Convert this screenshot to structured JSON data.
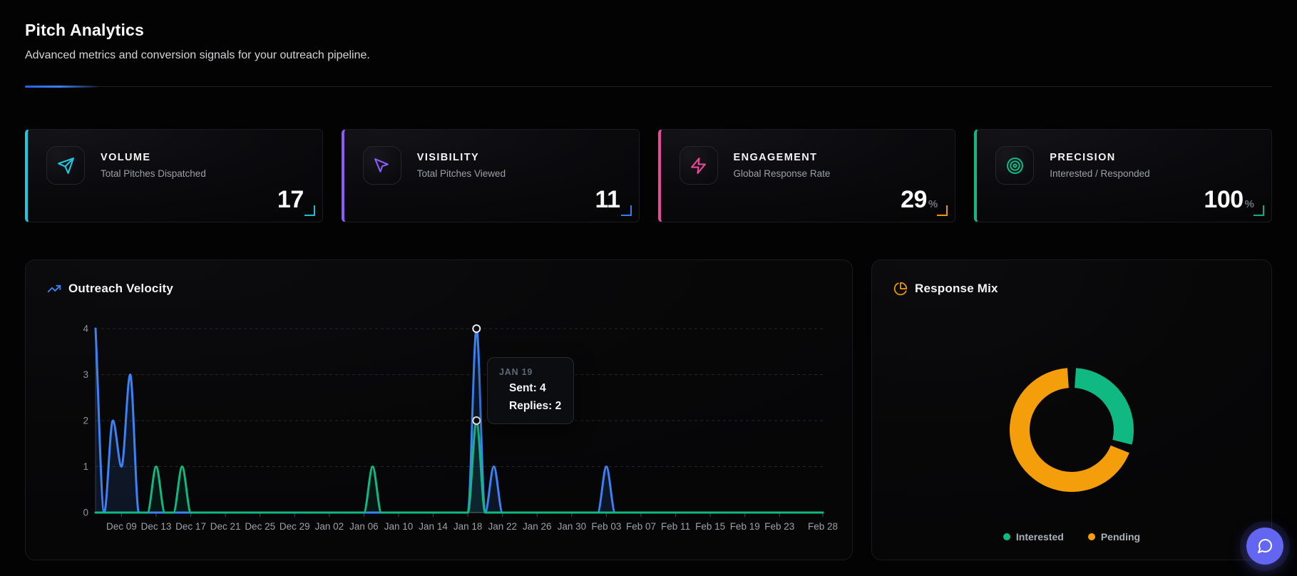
{
  "header": {
    "title": "Pitch Analytics",
    "subtitle": "Advanced metrics and conversion signals for your outreach pipeline."
  },
  "stats": [
    {
      "label": "VOLUME",
      "description": "Total Pitches Dispatched",
      "value": "17",
      "suffix": "",
      "accent": "#1fc8e0",
      "corner": "#1fc8e0",
      "icon": "send-icon"
    },
    {
      "label": "VISIBILITY",
      "description": "Total Pitches Viewed",
      "value": "11",
      "suffix": "",
      "accent": "#8b5cf6",
      "corner": "#3b82f6",
      "icon": "cursor-icon"
    },
    {
      "label": "ENGAGEMENT",
      "description": "Global Response Rate",
      "value": "29",
      "suffix": "%",
      "accent": "#ec4899",
      "corner": "#f59e0b",
      "icon": "bolt-icon"
    },
    {
      "label": "PRECISION",
      "description": "Interested / Responded",
      "value": "100",
      "suffix": "%",
      "accent": "#10b981",
      "corner": "#10b981",
      "icon": "target-icon"
    }
  ],
  "velocity": {
    "title": "Outreach Velocity",
    "title_icon": "trending-up-icon",
    "tooltip": {
      "date": "JAN 19",
      "sent": "Sent: 4",
      "replies": "Replies: 2"
    }
  },
  "mix": {
    "title": "Response Mix",
    "title_icon": "pie-chart-icon"
  },
  "chat": {
    "icon": "chat-icon",
    "color": "#6366f1"
  },
  "chart_data": [
    {
      "type": "line",
      "title": "Outreach Velocity",
      "xlabel": "",
      "ylabel": "",
      "ylim": [
        0,
        4
      ],
      "y_ticks": [
        0,
        1,
        2,
        3,
        4
      ],
      "grid": "dashed-horizontal",
      "legend_position": "none",
      "x_start_date": "Dec 06",
      "x_days_total": 84,
      "x_tick_labels": [
        "Dec 09",
        "Dec 13",
        "Dec 17",
        "Dec 21",
        "Dec 25",
        "Dec 29",
        "Jan 02",
        "Jan 06",
        "Jan 10",
        "Jan 14",
        "Jan 18",
        "Jan 22",
        "Jan 26",
        "Jan 30",
        "Feb 03",
        "Feb 07",
        "Feb 11",
        "Feb 15",
        "Feb 19",
        "Feb 23",
        "Feb 28"
      ],
      "x_tick_offsets": [
        3,
        7,
        11,
        15,
        19,
        23,
        27,
        31,
        35,
        39,
        43,
        47,
        51,
        55,
        59,
        63,
        67,
        71,
        75,
        79,
        84
      ],
      "series": [
        {
          "name": "Sent",
          "color": "#3b82f6",
          "fill": "rgba(59,130,246,0.13)",
          "baseline": 0,
          "points": [
            [
              0,
              4
            ],
            [
              2,
              2
            ],
            [
              3,
              1
            ],
            [
              4,
              3
            ],
            [
              44,
              4
            ],
            [
              46,
              1
            ],
            [
              59,
              1
            ]
          ]
        },
        {
          "name": "Replies",
          "color": "#10b981",
          "fill": "rgba(16,185,129,0.09)",
          "baseline": 0,
          "points": [
            [
              7,
              1
            ],
            [
              10,
              1
            ],
            [
              32,
              1
            ],
            [
              44,
              2
            ]
          ]
        }
      ],
      "highlight": {
        "date": "Jan 19",
        "offset": 44,
        "points": [
          [
            44,
            4
          ],
          [
            44,
            2
          ]
        ]
      }
    },
    {
      "type": "pie",
      "variant": "donut",
      "title": "Response Mix",
      "labels": [
        "Interested",
        "Pending"
      ],
      "values_percent": [
        29,
        71
      ],
      "colors": [
        "#10b981",
        "#f59e0b"
      ],
      "legend_position": "bottom"
    }
  ]
}
